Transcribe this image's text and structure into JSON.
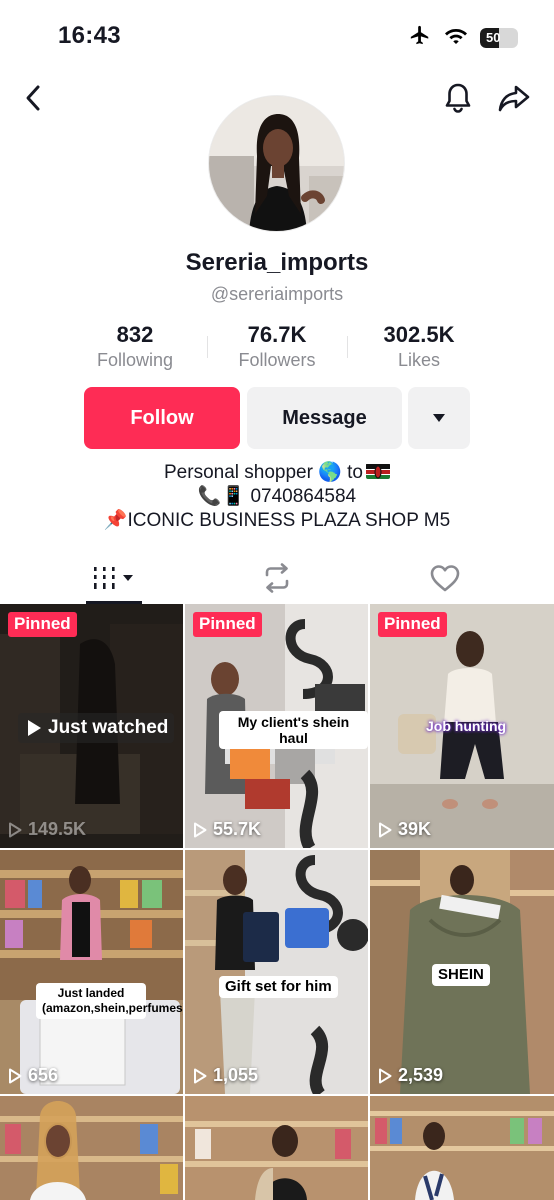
{
  "status_bar": {
    "time": "16:43",
    "battery": "50"
  },
  "profile": {
    "username": "Sereria_imports",
    "handle": "@sereriaimports",
    "stats": [
      {
        "value": "832",
        "label": "Following"
      },
      {
        "value": "76.7K",
        "label": "Followers"
      },
      {
        "value": "302.5K",
        "label": "Likes"
      }
    ],
    "buttons": {
      "follow": "Follow",
      "message": "Message"
    },
    "bio": {
      "line1": "Personal shopper 🌎 to",
      "line2": "📞📱 0740864584",
      "line3": "📌ICONIC BUSINESS PLAZA SHOP M5"
    }
  },
  "tabs": [
    "videos-grid-icon",
    "reposts-icon",
    "liked-icon"
  ],
  "grid": {
    "videos": [
      {
        "pinned": "Pinned",
        "overlay": "Just watched",
        "views": "149.5K"
      },
      {
        "pinned": "Pinned",
        "caption": "My client's shein haul",
        "views": "55.7K"
      },
      {
        "pinned": "Pinned",
        "caption": "Job hunting",
        "views": "39K"
      },
      {
        "caption": "Just landed (amazon,shein,perfumes)",
        "views": "656"
      },
      {
        "caption": "Gift set for him",
        "views": "1,055"
      },
      {
        "caption": "SHEIN",
        "views": "2,539"
      }
    ],
    "pinned_label": "Pinned"
  },
  "colors": {
    "accent": "#fe2c55",
    "text": "#161823",
    "muted": "#8a8b91",
    "button_grey": "#f1f1f2"
  }
}
